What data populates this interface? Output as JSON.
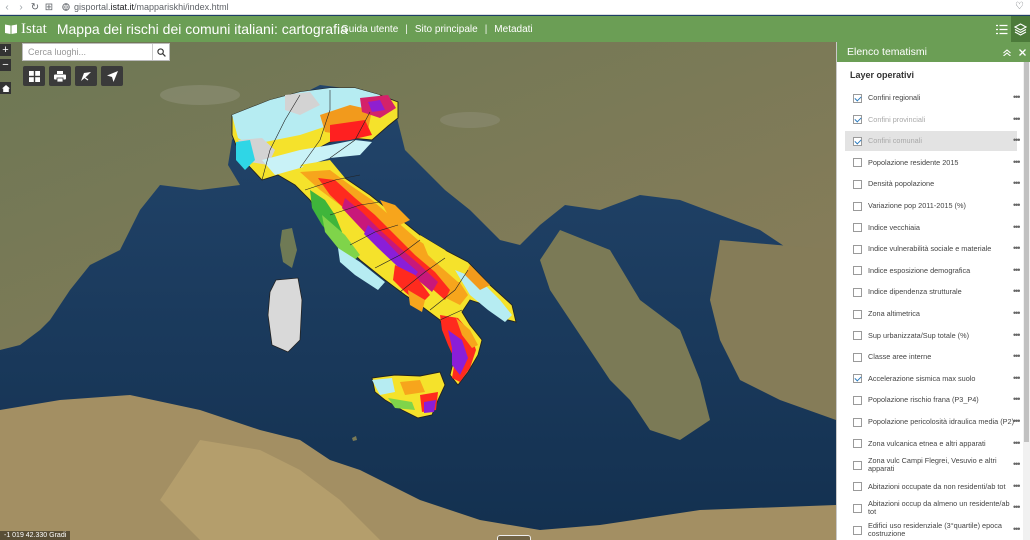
{
  "browser": {
    "url_prefix": "gisportal.",
    "url_domain": "istat.it",
    "url_path": "/mappariskhi/index.html"
  },
  "header": {
    "logo_text": "Istat",
    "title": "Mappa dei rischi dei comuni italiani: cartografia",
    "links": [
      "Guida utente",
      "Sito principale",
      "Metadati"
    ]
  },
  "search": {
    "placeholder": "Cerca luoghi..."
  },
  "map": {
    "zoom_in": "+",
    "zoom_out": "−",
    "coordinates": "-1 019 42.330 Gradi"
  },
  "panel": {
    "title": "Elenco tematismi",
    "section": "Layer operativi",
    "more": "•••",
    "layers": [
      {
        "label": "Confini regionali",
        "checked": true
      },
      {
        "label": "Confini provinciali",
        "checked": true,
        "dim": true
      },
      {
        "label": "Confini comunali",
        "checked": true,
        "dim": true,
        "highlight": true
      },
      {
        "label": "Popolazione residente 2015",
        "checked": false
      },
      {
        "label": "Densità popolazione",
        "checked": false
      },
      {
        "label": "Variazione pop 2011-2015 (%)",
        "checked": false
      },
      {
        "label": "Indice vecchiaia",
        "checked": false
      },
      {
        "label": "Indice vulnerabilità sociale e materiale",
        "checked": false
      },
      {
        "label": "Indice esposizione demografica",
        "checked": false
      },
      {
        "label": "Indice dipendenza strutturale",
        "checked": false
      },
      {
        "label": "Zona altimetrica",
        "checked": false
      },
      {
        "label": "Sup urbanizzata/Sup totale (%)",
        "checked": false
      },
      {
        "label": "Classe aree interne",
        "checked": false
      },
      {
        "label": "Accelerazione sismica max suolo",
        "checked": true
      },
      {
        "label": "Popolazione rischio frana (P3_P4)",
        "checked": false
      },
      {
        "label": "Popolazione pericolosità idraulica media (P2)",
        "checked": false
      },
      {
        "label": "Zona vulcanica etnea e altri apparati",
        "checked": false
      },
      {
        "label": "Zona vulc Campi Flegrei, Vesuvio e altri apparati",
        "checked": false
      },
      {
        "label": "Abitazioni occupate da non residenti/ab tot",
        "checked": false
      },
      {
        "label": "Abitazioni occup da almeno un residente/ab tot",
        "checked": false
      },
      {
        "label": "Edifici uso residenziale (3°quartile) epoca costruzione",
        "checked": false
      }
    ]
  },
  "colors": {
    "header_green": "#6b9e55",
    "sea": "#1d3f66"
  }
}
